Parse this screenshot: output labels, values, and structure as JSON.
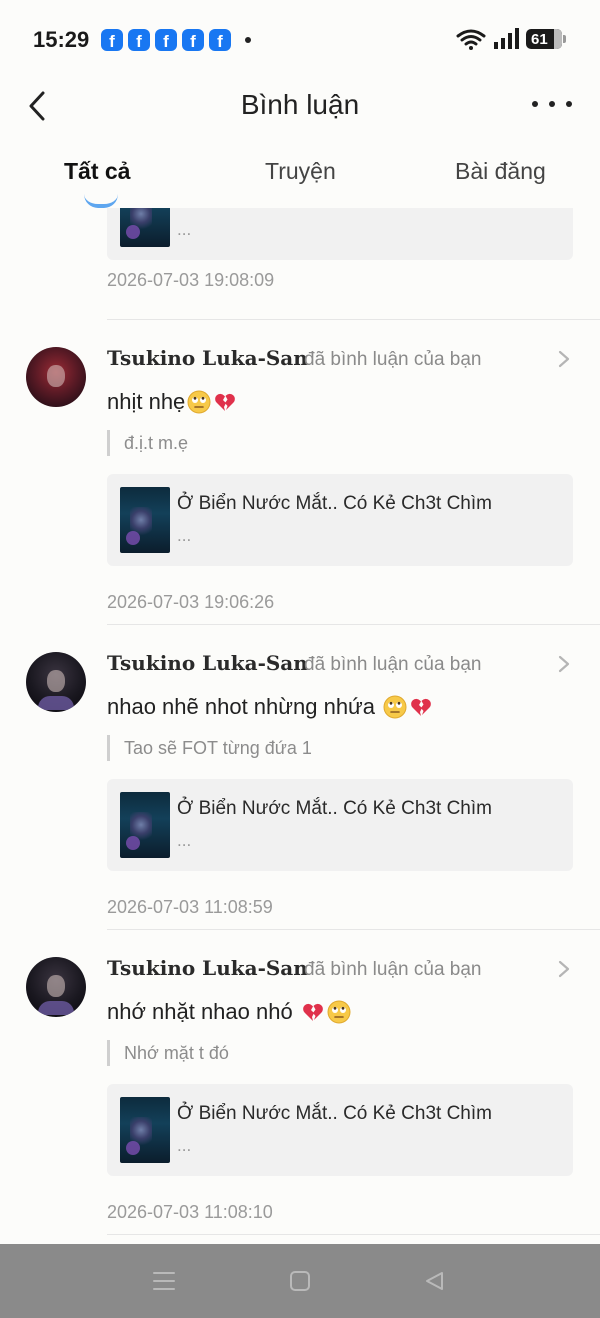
{
  "status_bar": {
    "time": "15:29",
    "notification_app_icons": [
      "facebook-icon",
      "facebook-icon",
      "facebook-icon",
      "facebook-icon",
      "facebook-icon"
    ],
    "notification_glyph": "f",
    "battery_level": "61"
  },
  "header": {
    "title": "Bình luận"
  },
  "tabs": [
    {
      "label": "Tất cả",
      "active": true
    },
    {
      "label": "Truyện",
      "active": false
    },
    {
      "label": "Bài đăng",
      "active": false
    }
  ],
  "partial_item": {
    "story_subtitle": "...",
    "timestamp": "2026-07-03 19:08:09"
  },
  "items": [
    {
      "username": "Tsukino Luka-San",
      "action": "đã bình luận của bạn",
      "comment": "nhịt nhẹ",
      "emojis": [
        "eye-roll-emoji",
        "broken-heart-emoji"
      ],
      "quote": "đ.ị.t m.ẹ",
      "story_title": "Ở Biển Nước Mắt.. Có Kẻ Ch3t Chìm",
      "story_subtitle": "...",
      "timestamp": "2026-07-03 19:06:26"
    },
    {
      "username": "Tsukino Luka-San",
      "action": "đã bình luận của bạn",
      "comment": "nhao nhẽ nhot nhừng nhứa ",
      "emojis": [
        "eye-roll-emoji",
        "broken-heart-emoji"
      ],
      "quote": "Tao sẽ FOT từng đứa 1",
      "story_title": "Ở Biển Nước Mắt.. Có Kẻ Ch3t Chìm",
      "story_subtitle": "...",
      "timestamp": "2026-07-03 11:08:59"
    },
    {
      "username": "Tsukino Luka-San",
      "action": "đã bình luận của bạn",
      "comment": "nhớ nhặt nhao nhó ",
      "emojis": [
        "broken-heart-emoji",
        "eye-roll-emoji"
      ],
      "quote": "Nhớ mặt t đó",
      "story_title": "Ở Biển Nước Mắt.. Có Kẻ Ch3t Chìm",
      "story_subtitle": "...",
      "timestamp": "2026-07-03 11:08:10"
    }
  ],
  "colors": {
    "tab_indicator": "#5ea6ef",
    "facebook_blue": "#1877f2"
  }
}
